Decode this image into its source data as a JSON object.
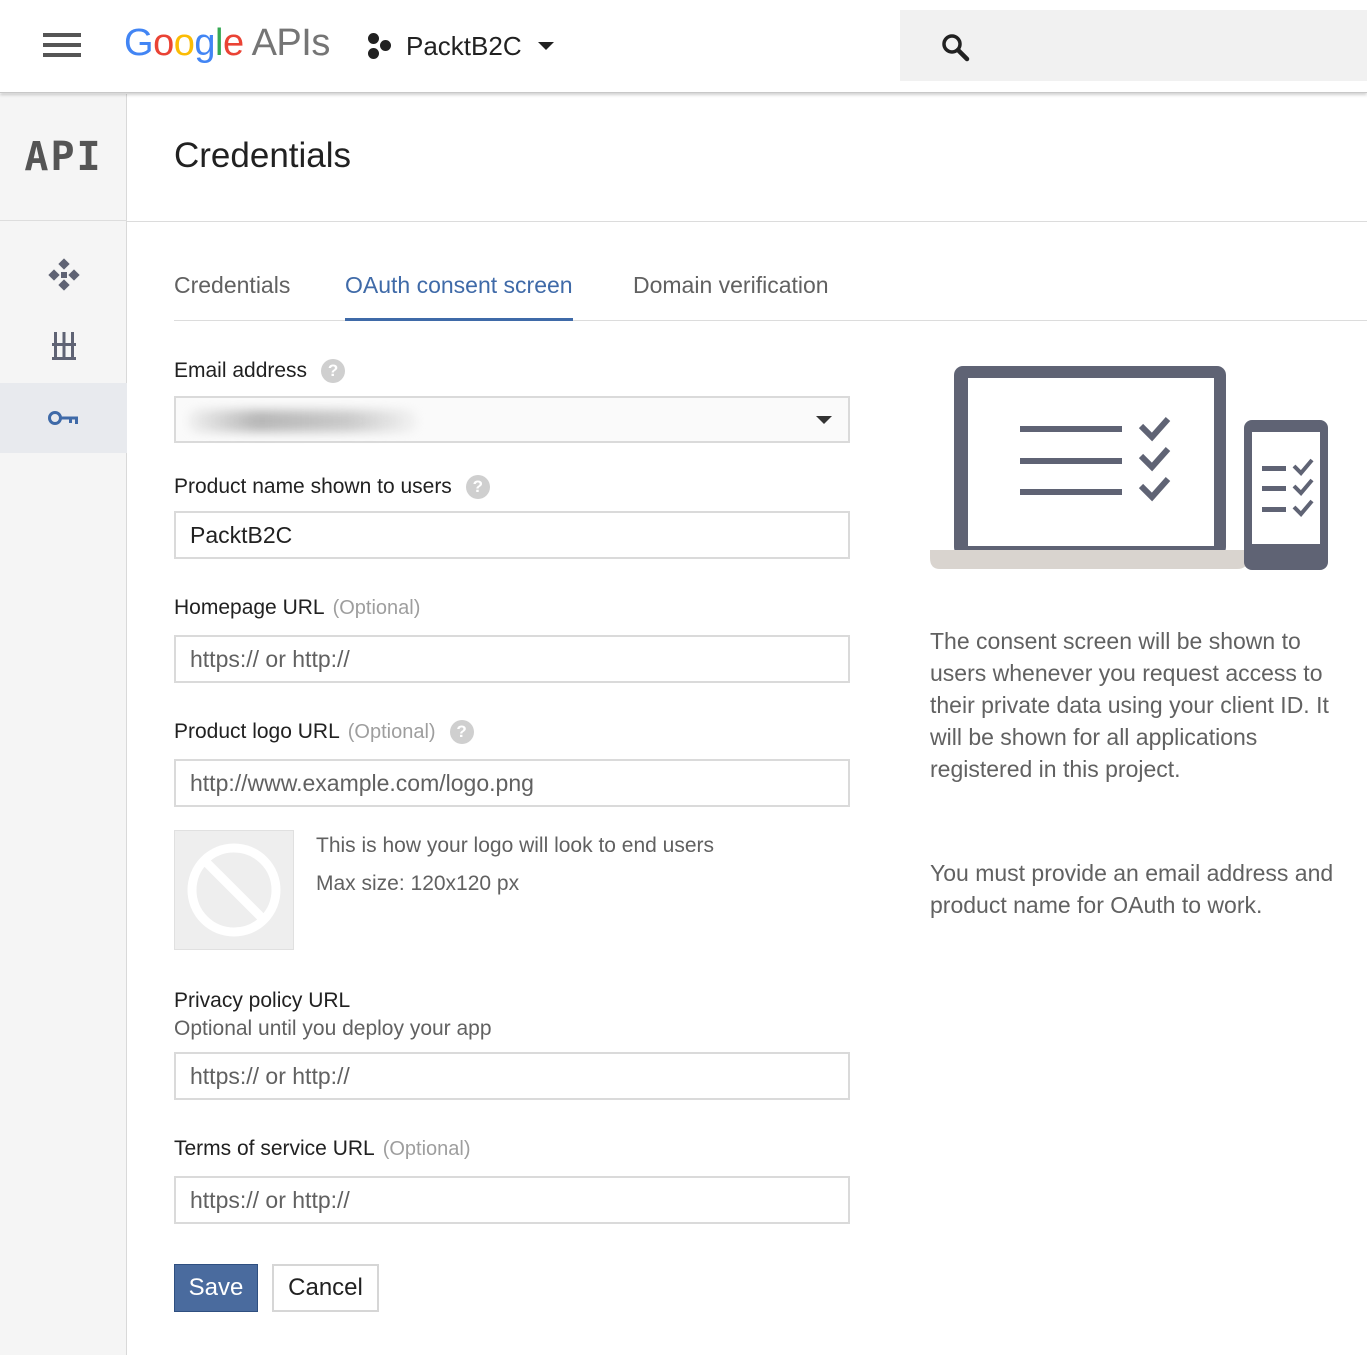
{
  "topbar": {
    "logo_letters": [
      "G",
      "o",
      "o",
      "g",
      "l",
      "e"
    ],
    "logo_suffix": "APIs",
    "project_name": "PacktB2C"
  },
  "sidebar": {
    "badge": "API",
    "items": [
      {
        "icon": "dashboard-icon"
      },
      {
        "icon": "library-icon"
      },
      {
        "icon": "key-icon",
        "active": true
      }
    ]
  },
  "page": {
    "title": "Credentials"
  },
  "tabs": [
    {
      "label": "Credentials",
      "active": false
    },
    {
      "label": "OAuth consent screen",
      "active": true
    },
    {
      "label": "Domain verification",
      "active": false
    }
  ],
  "form": {
    "email_label": "Email address",
    "product_name_label": "Product name shown to users",
    "product_name_value": "PacktB2C",
    "homepage_label": "Homepage URL",
    "optional_text": "(Optional)",
    "homepage_placeholder": "https:// or http://",
    "logo_label": "Product logo URL",
    "logo_placeholder": "http://www.example.com/logo.png",
    "logo_note": "This is how your logo will look to end users",
    "logo_max_size": "Max size: 120x120 px",
    "privacy_label": "Privacy policy URL",
    "privacy_sub": "Optional until you deploy your app",
    "privacy_placeholder": "https:// or http://",
    "tos_label": "Terms of service URL",
    "tos_placeholder": "https:// or http://",
    "save_label": "Save",
    "cancel_label": "Cancel",
    "help_glyph": "?"
  },
  "info": {
    "paragraph1": "The consent screen will be shown to users whenever you request access to their private data using your client ID. It will be shown for all applications registered in this project.",
    "paragraph2": "You must provide an email address and product name for OAuth to work."
  },
  "colors": {
    "accent": "#3f6aa8",
    "save_button": "#4a6b9e",
    "illustration_dark": "#5f6374",
    "illustration_base": "#d9d4cf"
  }
}
